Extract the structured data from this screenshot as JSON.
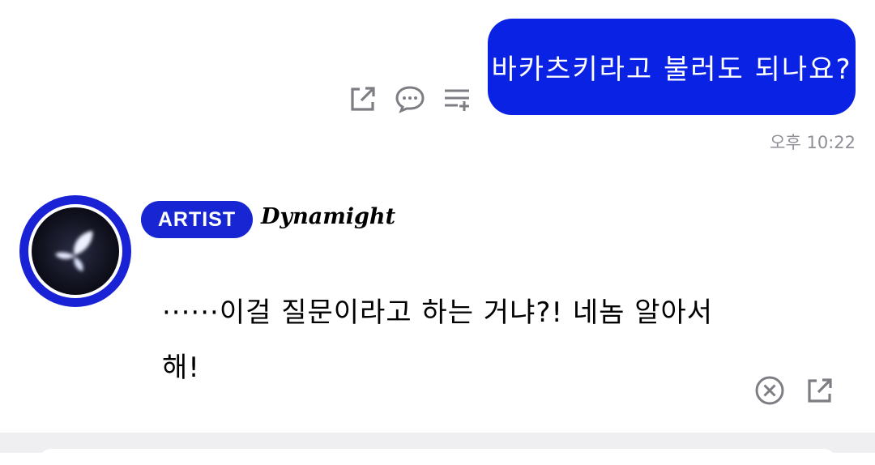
{
  "outgoing_message": {
    "text": "바카츠키라고 불러도 되나요?",
    "time": "오후 10:22",
    "actions": [
      "share-icon",
      "reply-bubble-icon",
      "add-to-list-icon"
    ]
  },
  "incoming_message": {
    "badge": "ARTIST",
    "sender": "Dynamight",
    "text": "······이걸 질문이라고 하는 거냐?! 네놈 알아서 해!",
    "actions": [
      "close-circle-icon",
      "share-icon"
    ]
  },
  "colors": {
    "bubble_accent": "#0a22e3",
    "badge_accent": "#1726d2",
    "timestamp_gray": "#8f8f98",
    "icon_gray": "#7d7d84"
  }
}
